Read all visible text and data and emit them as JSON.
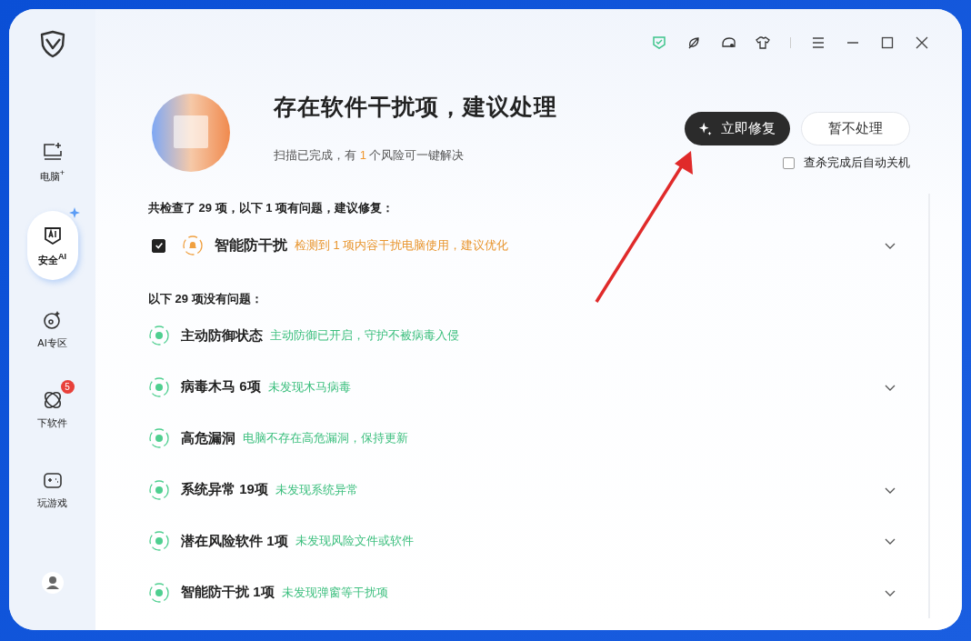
{
  "sidebar": {
    "items": [
      {
        "label": "电脑$^{+}$",
        "selected": false
      },
      {
        "label": "安全$^{AI}$",
        "selected": true
      },
      {
        "label": "AI专区",
        "selected": false
      },
      {
        "label": "下软件",
        "selected": false,
        "badge": "5"
      },
      {
        "label": "玩游戏",
        "selected": false
      }
    ]
  },
  "header": {
    "title": "存在软件干扰项，建议处理",
    "subtitle_before": "扫描已完成，有",
    "subtitle_count": "1",
    "subtitle_after": "个风险可一键解决",
    "primary_button": "立即修复",
    "secondary_button": "暂不处理",
    "auto_shutdown": {
      "label": "查杀完成后自动关机",
      "checked": false
    }
  },
  "issues_heading": "共检查了 29 项，以下 1 项有问题，建议修复：",
  "issues": [
    {
      "title": "智能防干扰",
      "detail": "检测到 1 项内容干扰电脑使用，建议优化",
      "checked": true,
      "expandable": true
    }
  ],
  "ok_heading": "以下 29 项没有问题：",
  "ok_items": [
    {
      "title": "主动防御状态",
      "detail": "主动防御已开启，守护不被病毒入侵",
      "expandable": false
    },
    {
      "title": "病毒木马 6项",
      "detail": "未发现木马病毒",
      "expandable": true
    },
    {
      "title": "高危漏洞",
      "detail": "电脑不存在高危漏洞，保持更新",
      "expandable": false
    },
    {
      "title": "系统异常 19项",
      "detail": "未发现系统异常",
      "expandable": true
    },
    {
      "title": "潜在风险软件 1项",
      "detail": "未发现风险文件或软件",
      "expandable": true
    },
    {
      "title": "智能防干扰 1项",
      "detail": "未发现弹窗等干扰项",
      "expandable": true
    }
  ]
}
